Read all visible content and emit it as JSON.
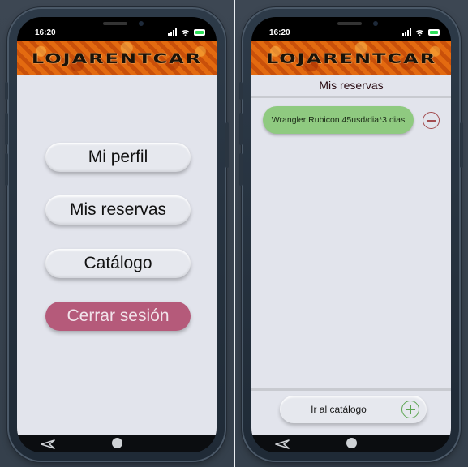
{
  "status_bar": {
    "time": "16:20"
  },
  "brand": {
    "logo_text": "LOJARENTCAR"
  },
  "left_screen": {
    "menu": [
      {
        "label": "Mi perfil"
      },
      {
        "label": "Mis reservas"
      },
      {
        "label": "Catálogo"
      },
      {
        "label": "Cerrar sesión"
      }
    ]
  },
  "right_screen": {
    "title": "Mis reservas",
    "reservations": [
      {
        "label": "Wrangler Rubicon 45usd/dia*3 dias"
      }
    ],
    "catalog_button": {
      "label": "Ir al catálogo"
    }
  },
  "colors": {
    "logout": "#b55a7a",
    "reservation": "#8fca80",
    "minus": "#a24c50",
    "plus": "#5ea654",
    "screen_bg": "#e2e4ec"
  },
  "icons": [
    "signal-icon",
    "wifi-icon",
    "battery-icon",
    "back-icon",
    "home-icon",
    "minus-icon",
    "plus-icon"
  ]
}
